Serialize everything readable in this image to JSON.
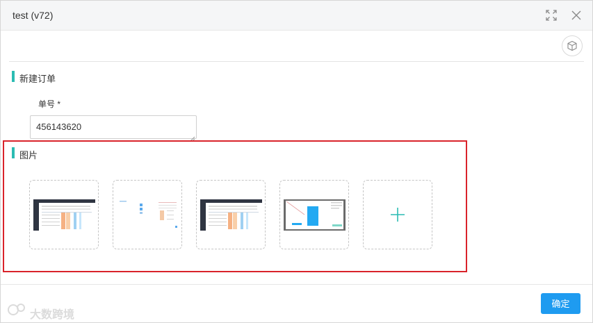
{
  "dialog": {
    "title": "test (v72)",
    "icons": {
      "fullscreen": "fullscreen-icon",
      "close": "close-icon",
      "cube": "cube-icon"
    }
  },
  "form": {
    "section_order": "新建订单",
    "order_no_label": "单号 *",
    "order_no_value": "456143620",
    "section_images": "图片"
  },
  "images": {
    "thumbnails": [
      {
        "name": "image-thumbnail-1"
      },
      {
        "name": "image-thumbnail-2"
      },
      {
        "name": "image-thumbnail-3"
      },
      {
        "name": "image-thumbnail-4"
      }
    ],
    "add_icon": "plus-icon"
  },
  "footer": {
    "confirm_label": "确定"
  },
  "watermark": {
    "text": "大数跨境"
  },
  "colors": {
    "accent": "#2bbcb3",
    "primary_button": "#1e9bf0",
    "highlight_border": "#d9232a"
  }
}
